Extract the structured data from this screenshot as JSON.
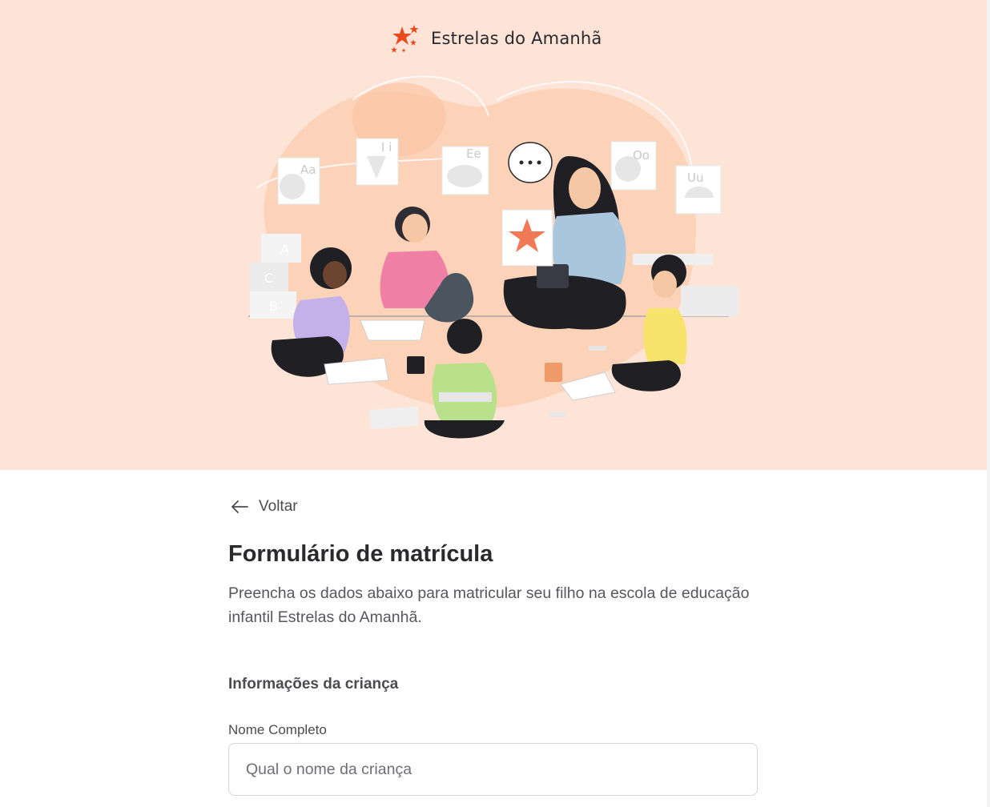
{
  "brand": {
    "name": "Estrelas do Amanhã",
    "accent_color": "#e8491d",
    "logo_icon": "stars-icon"
  },
  "hero": {
    "background_color": "#fee4d6",
    "illustration": "teacher-with-children-illustration",
    "cards": [
      "Aa",
      "I i",
      "Ee",
      "Oo",
      "Uu"
    ],
    "blocks": [
      "A",
      "C",
      "B"
    ]
  },
  "nav": {
    "back_label": "Voltar",
    "back_icon": "arrow-left-icon"
  },
  "form": {
    "title": "Formulário de matrícula",
    "description": "Preencha os dados abaixo para matricular seu filho na escola de educação infantil Estrelas do Amanhã.",
    "section_title": "Informações da criança",
    "full_name": {
      "label": "Nome Completo",
      "placeholder": "Qual o nome da criança",
      "value": ""
    }
  }
}
